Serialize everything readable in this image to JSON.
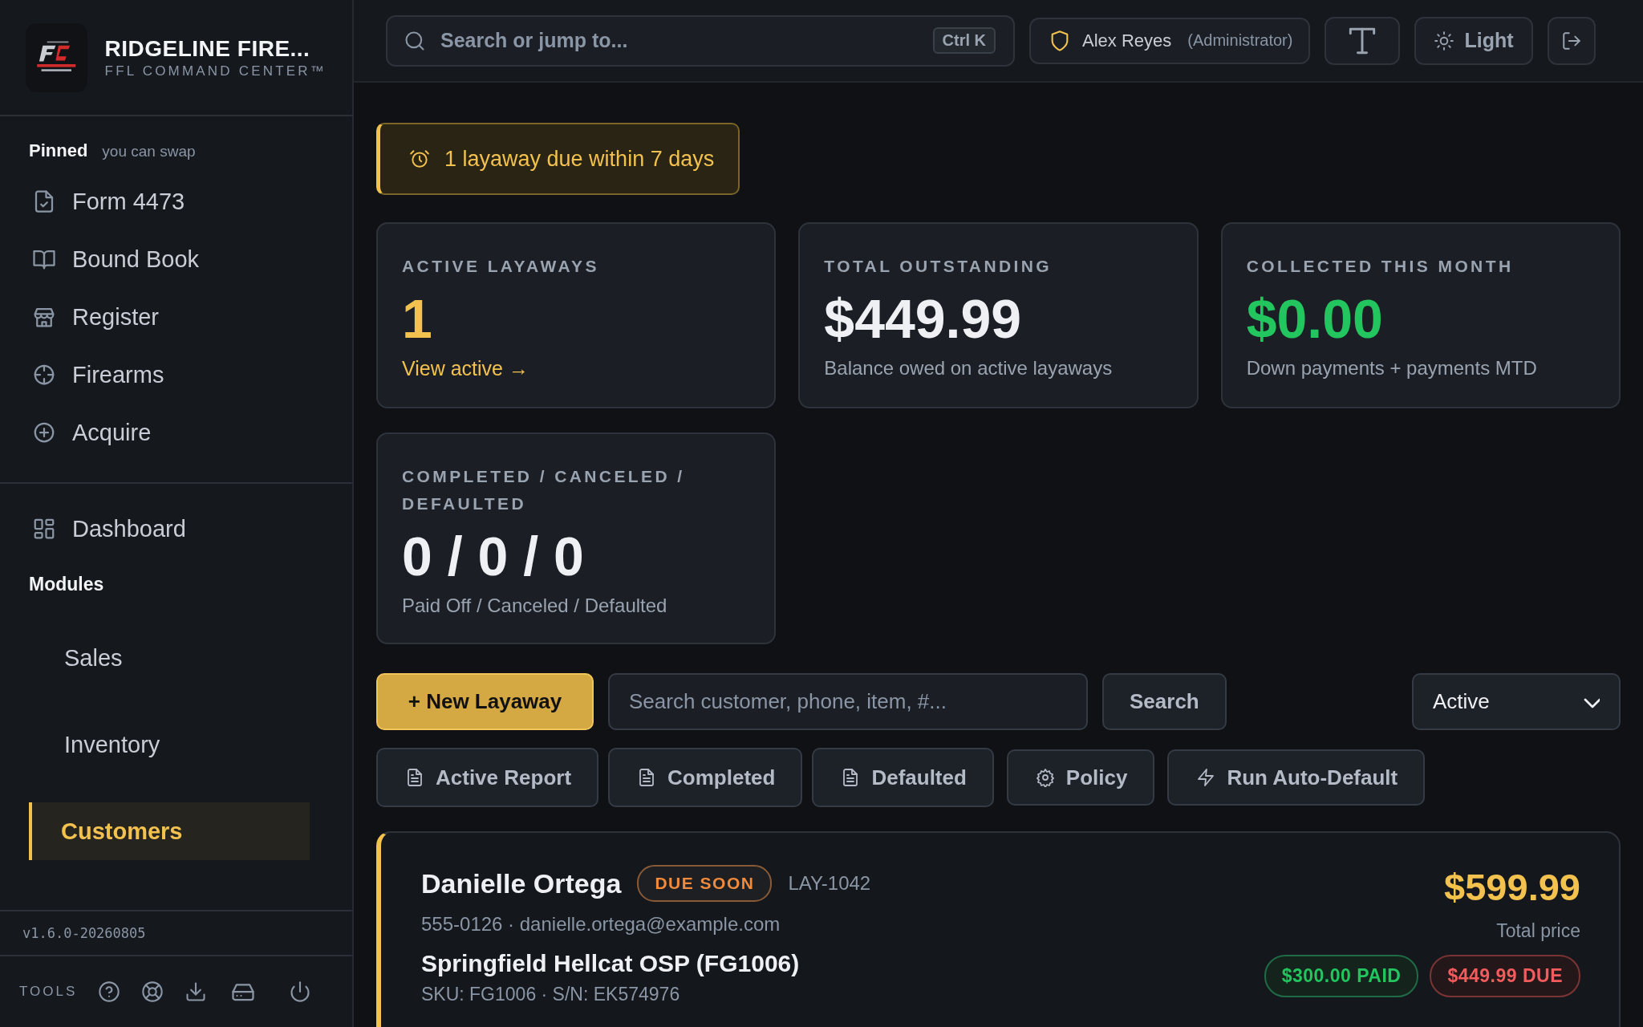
{
  "brand": {
    "name": "RIDGELINE FIRE...",
    "tagline": "FFL COMMAND CENTER™"
  },
  "sidebar": {
    "pinned_label": "Pinned",
    "pinned_hint": "you can swap",
    "pinned": [
      {
        "label": "Form 4473"
      },
      {
        "label": "Bound Book"
      },
      {
        "label": "Register"
      },
      {
        "label": "Firearms"
      },
      {
        "label": "Acquire"
      }
    ],
    "dashboard": "Dashboard",
    "modules_label": "Modules",
    "modules": [
      {
        "label": "Sales",
        "selected": false
      },
      {
        "label": "Inventory",
        "selected": false
      },
      {
        "label": "Customers",
        "selected": true
      }
    ],
    "version": "v1.6.0-20260805",
    "tools_label": "TOOLS"
  },
  "topbar": {
    "search": {
      "placeholder": "Search or jump to...",
      "shortcut": "Ctrl K"
    },
    "user": {
      "name": "Alex Reyes",
      "role": "(Administrator)"
    },
    "theme_button": "Light"
  },
  "alert": "1 layaway due within 7 days",
  "stats": [
    {
      "label": "ACTIVE LAYAWAYS",
      "value": "1",
      "color": "#f2c14e",
      "link": "View active →"
    },
    {
      "label": "TOTAL OUTSTANDING",
      "value": "$449.99",
      "color": "#eef0f3",
      "note": "Balance owed on active layaways"
    },
    {
      "label": "COLLECTED THIS MONTH",
      "value": "$0.00",
      "color": "#22c55e",
      "note": "Down payments + payments MTD"
    },
    {
      "label": "COMPLETED / CANCELED / DEFAULTED",
      "value": "0 / 0 / 0",
      "color": "#eef0f3",
      "note": "Paid Off / Canceled / Defaulted"
    }
  ],
  "toolbar": {
    "new_button": "+ New Layaway",
    "search": {
      "placeholder": "Search customer, phone, item, #..."
    },
    "search_button": "Search",
    "filter": {
      "value": "Active"
    },
    "reports": [
      {
        "label": "Active Report"
      },
      {
        "label": "Completed"
      },
      {
        "label": "Defaulted"
      }
    ],
    "actions": [
      {
        "label": "Policy"
      },
      {
        "label": "Run Auto-Default"
      }
    ]
  },
  "layaways": [
    {
      "customer": "Danielle Ortega",
      "status": "DUE SOON",
      "number": "LAY-1042",
      "contact": "555-0126 · danielle.ortega@example.com",
      "item": "Springfield Hellcat OSP (FG1006)",
      "ids": "SKU: FG1006 · S/N: EK574976",
      "total": "$599.99",
      "total_label": "Total price",
      "paid": "$300.00 PAID",
      "due": "$449.99 DUE"
    }
  ]
}
